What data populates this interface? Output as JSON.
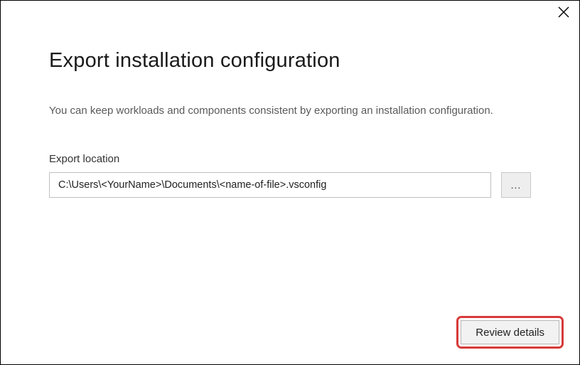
{
  "dialog": {
    "title": "Export installation configuration",
    "description": "You can keep workloads and components consistent by exporting an installation configuration.",
    "exportLocationLabel": "Export location",
    "exportPath": "C:\\Users\\<YourName>\\Documents\\<name-of-file>.vsconfig",
    "browseLabel": "...",
    "reviewDetailsLabel": "Review details"
  }
}
